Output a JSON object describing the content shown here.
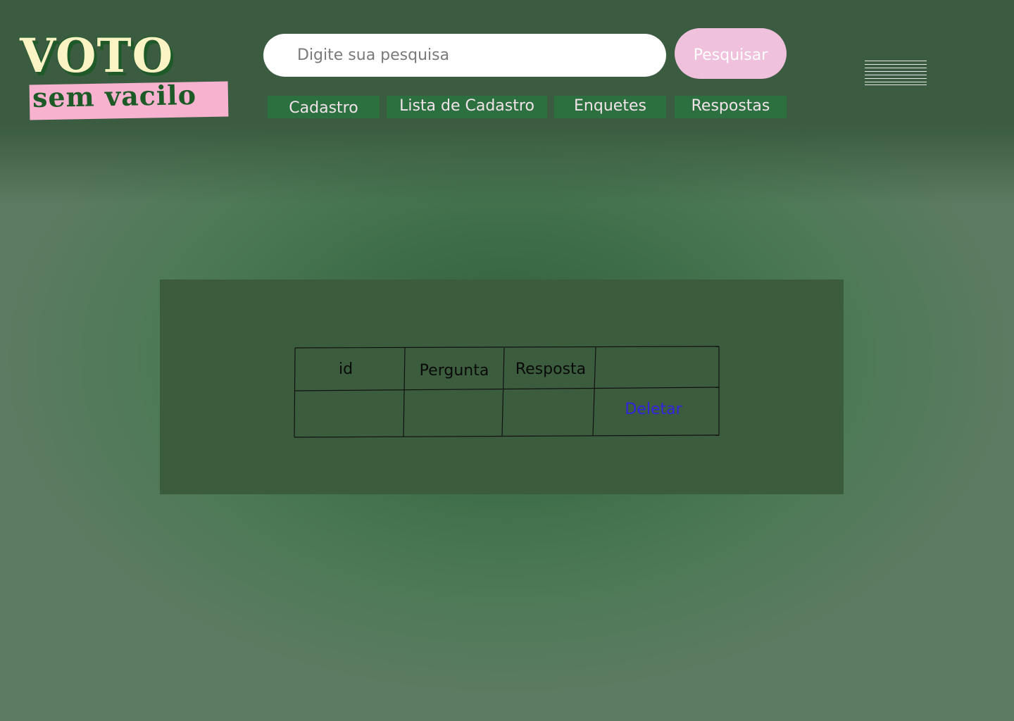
{
  "logo": {
    "line1": "VOTO",
    "line2": "sem vacilo"
  },
  "search": {
    "placeholder": "Digite sua pesquisa",
    "value": "",
    "button_label": "Pesquisar"
  },
  "nav": [
    {
      "label": "Cadastro"
    },
    {
      "label": "Lista de Cadastro"
    },
    {
      "label": "Enquetes"
    },
    {
      "label": "Respostas"
    }
  ],
  "menu_icon": "hamburger-icon",
  "table": {
    "headers": [
      "id",
      "Pergunta",
      "Resposta",
      ""
    ],
    "rows": [
      {
        "id": "",
        "pergunta": "",
        "resposta": "",
        "action_label": "Deletar"
      }
    ]
  },
  "colors": {
    "header": "#3b5c40",
    "panel": "#3c5c3e",
    "nav": "#2c7040",
    "search_button": "#f0c1dd",
    "logo_cream": "#fbf3c4",
    "logo_pink": "#f6b2cf",
    "delete_link": "#3322e0"
  }
}
